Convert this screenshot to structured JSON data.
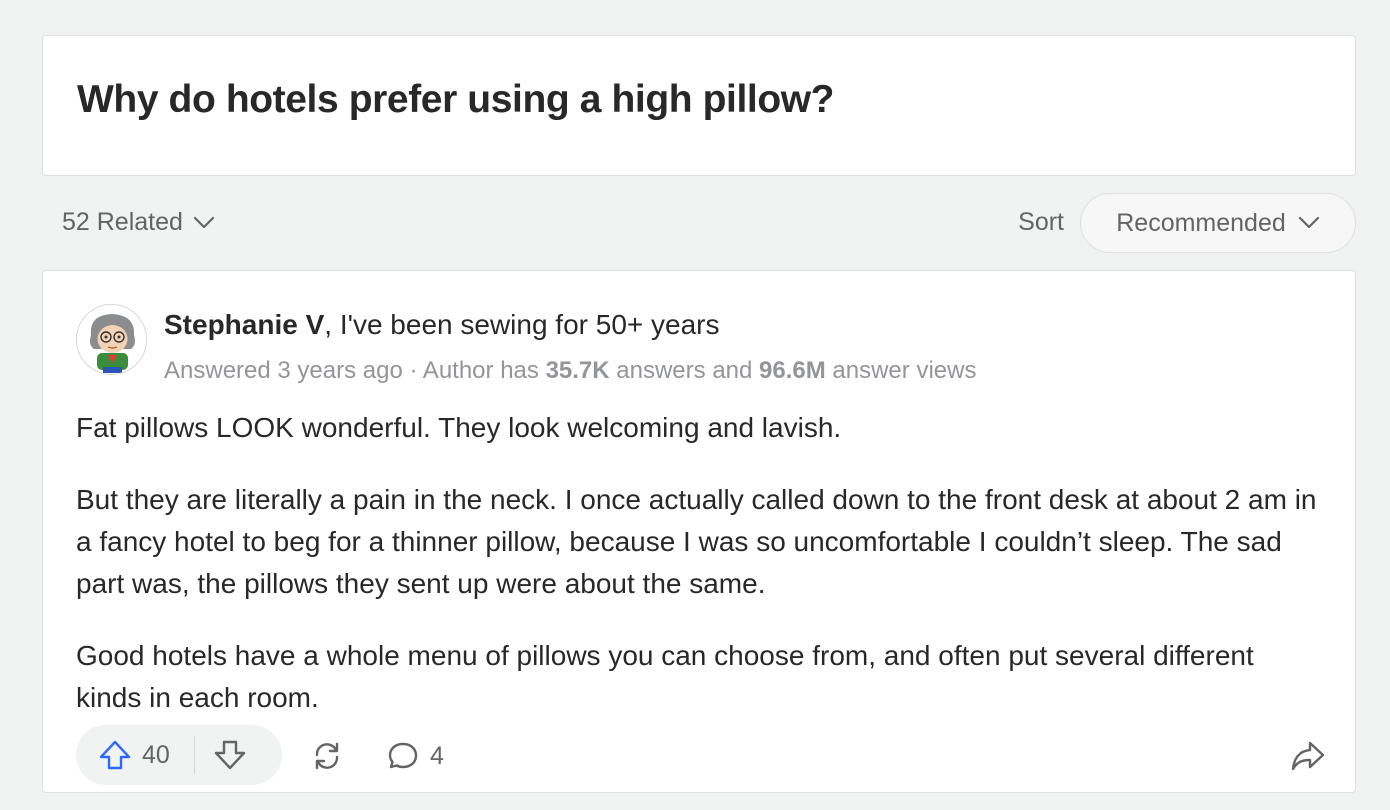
{
  "question": {
    "title": "Why do hotels prefer using a high pillow?"
  },
  "toolbar": {
    "related_label": "52 Related",
    "sort_label": "Sort",
    "sort_value": "Recommended"
  },
  "answer": {
    "author_name": "Stephanie V",
    "author_credential": ", I've been sewing for 50+ years",
    "meta_prefix": "Answered 3 years ago · Author has ",
    "answers_count": "35.7K",
    "meta_mid": " answers and ",
    "views_count": "96.6M",
    "meta_suffix": " answer views",
    "paragraphs": [
      "Fat pillows LOOK wonderful. They look welcoming and lavish.",
      "But they are literally a pain in the neck. I once actually called down to the front desk at about 2 am in a fancy hotel to beg for a thinner pillow, because I was so uncomfortable I couldn’t sleep. The sad part was, the pillows they sent up were about the same.",
      "Good hotels have a whole menu of pillows you can choose from, and often put several different kinds in each room."
    ]
  },
  "actions": {
    "upvote_count": "40",
    "comment_count": "4"
  },
  "colors": {
    "upvote_blue": "#2e69ff",
    "icon_gray": "#636466"
  },
  "icons": [
    "chevron-down-icon",
    "upvote-arrow-icon",
    "downvote-arrow-icon",
    "reshare-icon",
    "comment-icon",
    "share-arrow-icon"
  ]
}
